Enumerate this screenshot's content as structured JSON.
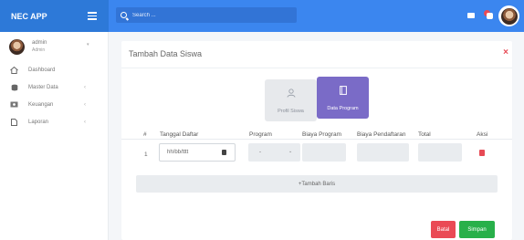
{
  "app": {
    "title": "NEC APP"
  },
  "search": {
    "placeholder": "Search ..."
  },
  "user": {
    "name": "admin",
    "role": "Admin"
  },
  "sidebar": {
    "items": [
      {
        "label": "Dashboard",
        "icon": "home-icon"
      },
      {
        "label": "Master Data",
        "icon": "database-icon"
      },
      {
        "label": "Keuangan",
        "icon": "money-icon"
      },
      {
        "label": "Laporan",
        "icon": "file-icon"
      }
    ]
  },
  "card": {
    "title": "Tambah Data Siswa",
    "close": "×"
  },
  "tiles": {
    "profil": "Profil Siswa",
    "program": "Data Program"
  },
  "table": {
    "headers": [
      "#",
      "Tanggal Daftar",
      "Program",
      "Biaya Program",
      "Biaya Pendaftaran",
      "Total",
      "Aksi"
    ],
    "row": {
      "no": "1",
      "date": "hh/bb/tttt",
      "program": "-"
    }
  },
  "actions": {
    "add_row": "+Tambah Baris",
    "cancel": "Batal",
    "save": "Simpan"
  },
  "colors": {
    "brand": "#2d79d8",
    "topbar": "#3b86ef",
    "accent": "#7a6bc7",
    "danger": "#ea4a55",
    "success": "#28b04a"
  }
}
